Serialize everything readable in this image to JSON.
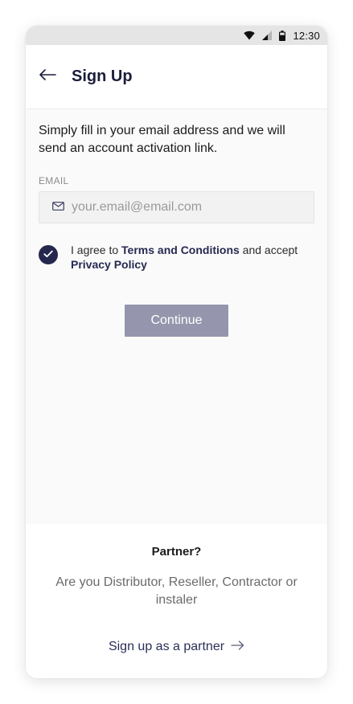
{
  "status_bar": {
    "time": "12:30",
    "icons": [
      "wifi-icon",
      "signal-icon",
      "battery-icon"
    ]
  },
  "header": {
    "back_icon": "arrow-left-icon",
    "title": "Sign Up"
  },
  "form": {
    "intro": "Simply fill in your email address and we will send an account activation link.",
    "email_label": "EMAIL",
    "email_icon": "mail-icon",
    "email_placeholder": "your.email@email.com",
    "email_value": "",
    "agree": {
      "checked": true,
      "prefix": "I agree to ",
      "terms_link": "Terms and Conditions",
      "middle": " and accept ",
      "privacy_link": "Privacy Policy"
    },
    "continue_label": "Continue"
  },
  "partner": {
    "title": "Partner?",
    "text": "Are you Distributor, Reseller, Contractor or instaler",
    "link_label": "Sign up as a partner",
    "link_icon": "arrow-right-icon"
  },
  "colors": {
    "primary": "#25274d",
    "button_disabled": "#9596ad",
    "status_bar": "#e5e5e5"
  }
}
